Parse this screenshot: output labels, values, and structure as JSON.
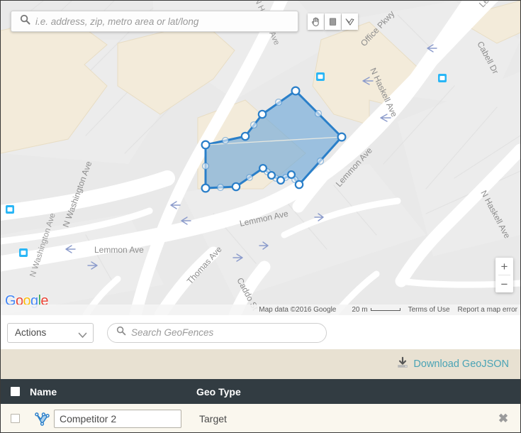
{
  "map": {
    "search": {
      "placeholder": "i.e. address, zip, metro area or lat/long",
      "value": "",
      "icon": "search-icon"
    },
    "tools": [
      {
        "name": "pan-hand-tool",
        "label": "Pan",
        "icon": "hand-icon",
        "selected": true
      },
      {
        "name": "rectangle-tool",
        "label": "Draw Rectangle",
        "icon": "square-icon",
        "selected": false
      },
      {
        "name": "polygon-tool",
        "label": "Draw Polygon",
        "icon": "polygon-icon",
        "selected": false
      }
    ],
    "zoom_in_label": "+",
    "zoom_out_label": "−",
    "logo": {
      "letters": [
        "G",
        "o",
        "o",
        "g",
        "l",
        "e"
      ]
    },
    "attribution": {
      "map_data": "Map data ©2016 Google",
      "scale": "20 m",
      "terms": "Terms of Use",
      "report": "Report a map error"
    },
    "street_labels": [
      "Office Pkwy",
      "N Haskell Ave",
      "Lemmon Ave",
      "Cabell Dr",
      "N Washington Ave",
      "Lemmon Ave",
      "Lemmon Ave",
      "N Haskell Ave",
      "Thomas Ave",
      "Caddo St"
    ],
    "colors": {
      "base": "#e9e9e9",
      "road": "#ffffff",
      "building": "#f3ebda",
      "polygon_fill": "#6ba7d8",
      "polygon_stroke": "#2a7fc9",
      "transit_marker": "#29b6f6"
    }
  },
  "toolbar": {
    "actions_label": "Actions",
    "actions_options": [
      "Actions"
    ],
    "search_placeholder": "Search GeoFences",
    "search_value": ""
  },
  "download": {
    "label": "Download GeoJSON",
    "icon": "download-icon",
    "color": "#4aa3b5"
  },
  "table": {
    "columns": [
      "Name",
      "Geo Type"
    ],
    "header_checkbox_checked": false,
    "rows": [
      {
        "checked": false,
        "icon": "geofence-polygon-icon",
        "name": "Competitor 2",
        "geo_type": "Target",
        "delete_label": "✖"
      }
    ]
  }
}
